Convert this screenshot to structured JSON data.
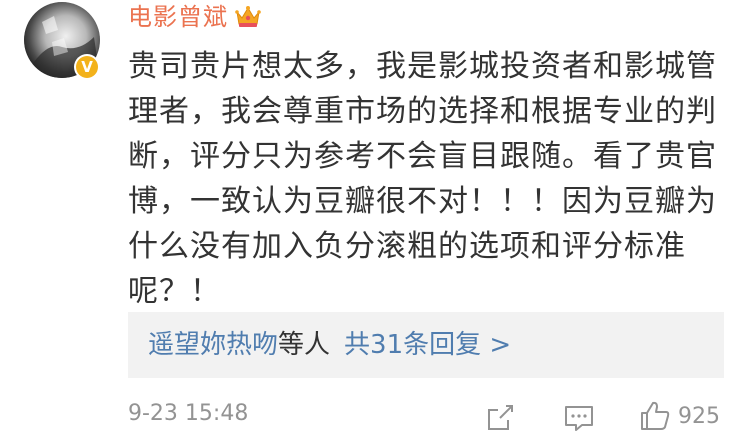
{
  "comment": {
    "username": "电影曾斌",
    "avatar_icon": "avatar-image",
    "verified_icon": "verified-v-badge",
    "verified_glyph": "V",
    "vip_icon": "crown-vip-icon",
    "content_lines": [
      "贵司贵片想太多，我是影城投资者和影城管",
      "理者，我会尊重市场的选择和根据专业的判",
      "断，评分只为参考不会盲目跟随。看了贵官",
      "博，一致认为豆瓣很不对！！！因为豆瓣为",
      "什么没有加入负分滚粗的选项和评分标准",
      "呢？！"
    ],
    "replies": {
      "users": "遥望妳热吻",
      "suffix": "等人",
      "count_text": "共31条回复 >"
    },
    "timestamp": "9-23 15:48",
    "actions": {
      "share_icon": "share-icon",
      "comment_icon": "comment-icon",
      "like_icon": "thumbs-up-icon",
      "like_count": "925"
    }
  },
  "colors": {
    "username": "#eb7350",
    "link": "#507daf",
    "text": "#333333",
    "meta": "#939393",
    "reply_bg": "#f2f2f2",
    "badge": "#f3b21b"
  }
}
